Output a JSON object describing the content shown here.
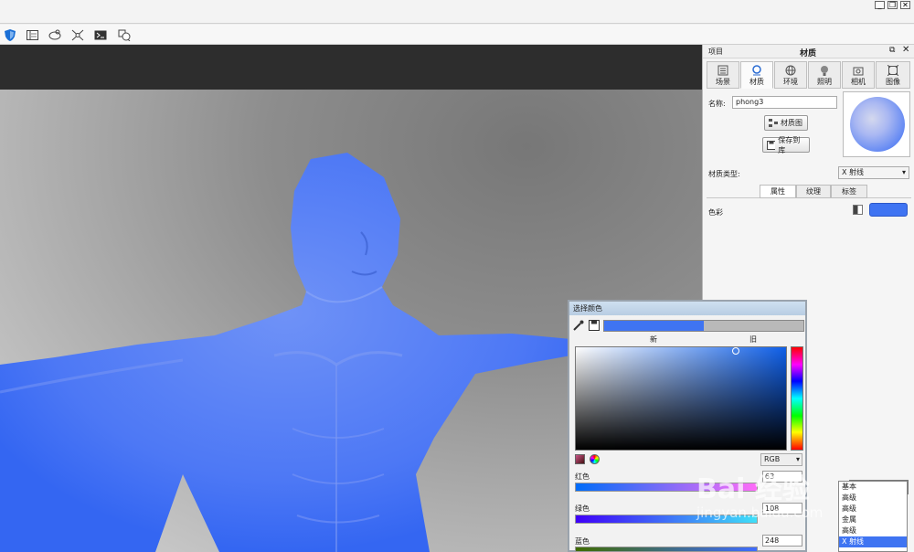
{
  "window": {
    "minimize": "_",
    "restore": "❐",
    "close": "✕"
  },
  "toolbar": {
    "icons": [
      "shield-icon",
      "layout-icon",
      "orbit-icon",
      "transform-icon",
      "terminal-icon",
      "render-icon"
    ]
  },
  "panel": {
    "project_label": "项目",
    "title": "材质",
    "tabs": [
      "场景",
      "材质",
      "环境",
      "照明",
      "相机",
      "图像"
    ],
    "active_tab": 1,
    "name_label": "名称:",
    "name_value": "phong3",
    "material_graph_button": "材质图",
    "save_to_library_button": "保存到库",
    "material_type_label": "材质类型:",
    "material_type_value": "X 射线",
    "subtabs": [
      "属性",
      "纹理",
      "标签"
    ],
    "active_subtab": 0,
    "color_label": "色彩",
    "color_swatch": "#3f74f2"
  },
  "picker": {
    "title": "选择颜色",
    "new_label": "新",
    "old_label": "旧",
    "mode_value": "RGB",
    "red_label": "红色",
    "red_value": "63",
    "green_label": "绿色",
    "green_value": "108",
    "blue_label": "蓝色",
    "blue_value": "248"
  },
  "dropdown": {
    "items": [
      "基本",
      "高级",
      "高级",
      "金属",
      "高级",
      "X 射线"
    ]
  },
  "watermark": {
    "line1": "Bai 经验",
    "line2": "jingyan.baidu.com"
  }
}
